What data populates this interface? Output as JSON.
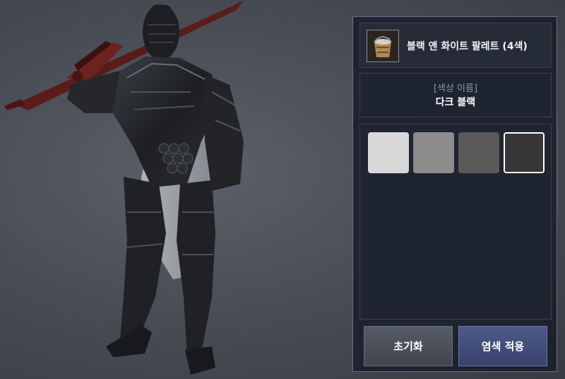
{
  "item": {
    "name": "블랙 앤 화이트 팔레트 (4색)",
    "icon": "dye-bucket-icon"
  },
  "color_info": {
    "label": "[색상 이름]",
    "value": "다크 블랙"
  },
  "swatches": [
    {
      "color": "#d8d8d8",
      "selected": false
    },
    {
      "color": "#8c8c8c",
      "selected": false
    },
    {
      "color": "#595959",
      "selected": false
    },
    {
      "color": "#363636",
      "selected": true
    }
  ],
  "buttons": {
    "reset_label": "초기화",
    "apply_label": "염색 적용"
  },
  "colors": {
    "panel_bg": "#1c202c",
    "apply_button": "#4d5a8a",
    "reset_button": "#565c66"
  }
}
